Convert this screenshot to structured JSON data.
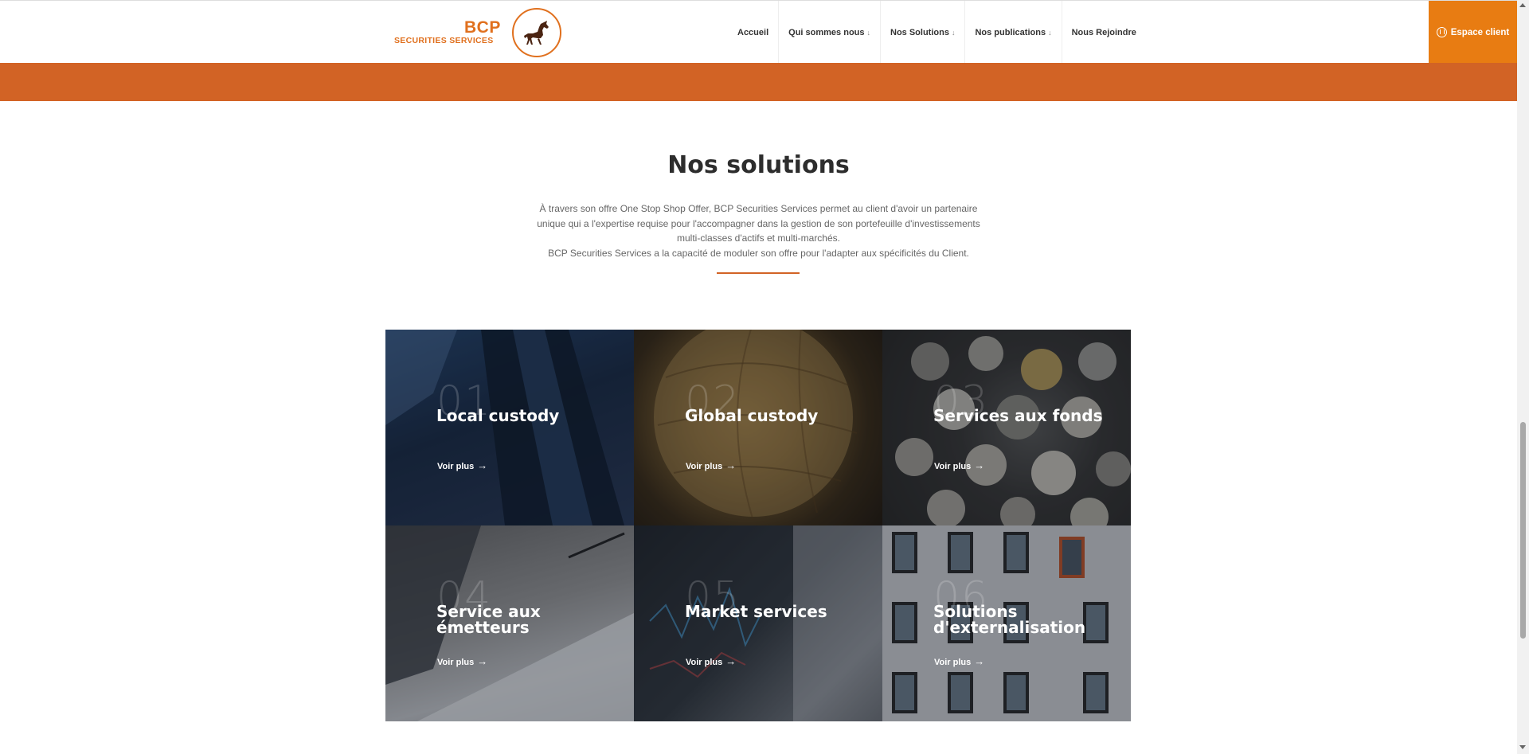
{
  "header": {
    "logo": {
      "name": "BCP",
      "subtitle": "SECURITIES SERVICES"
    },
    "nav": [
      {
        "label": "Accueil",
        "has_dropdown": false
      },
      {
        "label": "Qui sommes nous",
        "has_dropdown": true
      },
      {
        "label": "Nos Solutions",
        "has_dropdown": true
      },
      {
        "label": "Nos publications",
        "has_dropdown": true
      },
      {
        "label": "Nous Rejoindre",
        "has_dropdown": false
      }
    ],
    "dropdown_icon": "↓",
    "espace_client": "Espace client"
  },
  "colors": {
    "accent": "#e87c12",
    "band": "#d26325"
  },
  "section": {
    "title": "Nos solutions",
    "description_lines": [
      "À travers son offre One Stop Shop Offer, BCP Securities Services permet au client d'avoir un partenaire",
      "unique qui a l'expertise requise pour l'accompagner dans la gestion de son portefeuille d'investissements",
      "multi-classes d'actifs et multi-marchés.",
      "BCP Securities Services a la capacité de moduler son offre pour l'adapter aux spécificités du Client."
    ]
  },
  "solutions": [
    {
      "num": "01",
      "title": "Local custody",
      "link": "Voir plus",
      "arrow": "→"
    },
    {
      "num": "02",
      "title": "Global custody",
      "link": "Voir plus",
      "arrow": "→"
    },
    {
      "num": "03",
      "title": "Services aux fonds",
      "link": "Voir plus",
      "arrow": "→"
    },
    {
      "num": "04",
      "title": "Service aux émetteurs",
      "link": "Voir plus",
      "arrow": "→"
    },
    {
      "num": "05",
      "title": "Market services",
      "link": "Voir plus",
      "arrow": "→"
    },
    {
      "num": "06",
      "title": "Solutions d'externalisation",
      "link": "Voir plus",
      "arrow": "→"
    }
  ]
}
